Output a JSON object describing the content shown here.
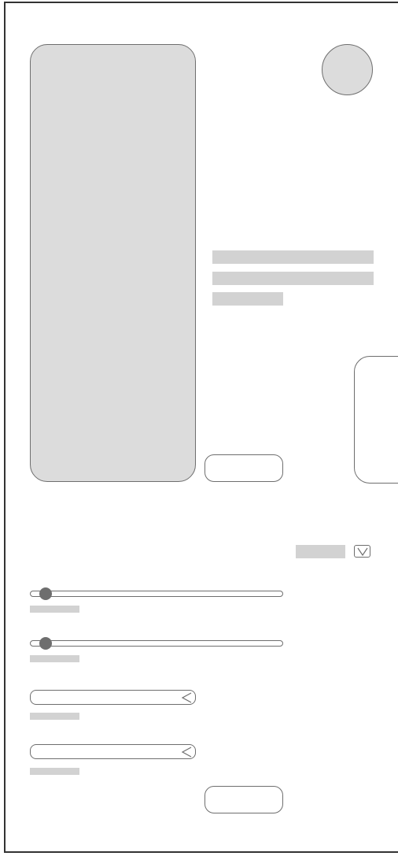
{
  "media_card": {
    "icon": "image-placeholder"
  },
  "avatar": {
    "icon": "avatar-placeholder"
  },
  "description": {
    "lines": [
      "",
      "",
      ""
    ]
  },
  "primary_button": {
    "label": ""
  },
  "side_panel": {
    "label": ""
  },
  "dropdown": {
    "selected": "",
    "icon": "chevron-down-icon"
  },
  "sliders": [
    {
      "value": 0.06,
      "caption": ""
    },
    {
      "value": 0.06,
      "caption": ""
    }
  ],
  "comboboxes": [
    {
      "value": "",
      "caption": "",
      "icon": "chevron-left-icon"
    },
    {
      "value": "",
      "caption": "",
      "icon": "chevron-left-icon"
    }
  ],
  "secondary_button": {
    "label": ""
  },
  "colors": {
    "placeholder_fill": "#dcdcdc",
    "outline": "#6e6e6e",
    "text_placeholder": "#d2d2d2",
    "frame": "#333333"
  }
}
